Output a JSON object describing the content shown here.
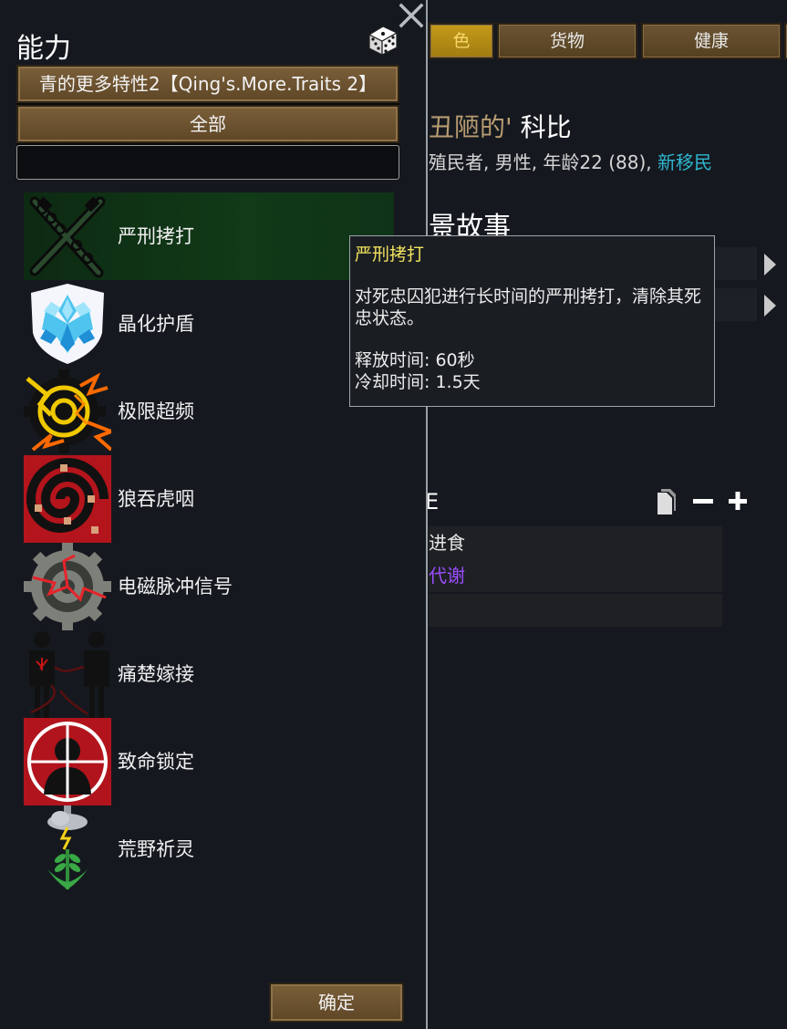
{
  "background": {
    "tabs": [
      "色",
      "货物",
      "健康"
    ],
    "name_prefix": "丑陋的'",
    "name": " 科比",
    "subtitle": "殖民者, 男性, 年龄22 (88),",
    "subtitle_link": "新移民",
    "story_header": "景故事",
    "section_header": "E",
    "traits": [
      "进食",
      "代谢"
    ],
    "trait_colors": [
      "#e8e8e8",
      "#9b4dff"
    ]
  },
  "dialog": {
    "title": "能力",
    "filter_mod": "青的更多特性2【Qing's.More.Traits 2】",
    "filter_category": "全部",
    "search_value": "",
    "confirm_label": "确定",
    "abilities": [
      {
        "label": "严刑拷打",
        "icon": "chain-torture-icon",
        "selected": true
      },
      {
        "label": "晶化护盾",
        "icon": "crystal-shield-icon",
        "selected": false
      },
      {
        "label": "极限超频",
        "icon": "overclock-gear-icon",
        "selected": false
      },
      {
        "label": "狼吞虎咽",
        "icon": "vortex-devour-icon",
        "selected": false
      },
      {
        "label": "电磁脉冲信号",
        "icon": "emp-gear-icon",
        "selected": false
      },
      {
        "label": "痛楚嫁接",
        "icon": "pain-graft-icon",
        "selected": false
      },
      {
        "label": "致命锁定",
        "icon": "crosshair-lock-icon",
        "selected": false
      },
      {
        "label": "荒野祈灵",
        "icon": "wild-prayer-icon",
        "selected": false
      }
    ]
  },
  "tooltip": {
    "title": "严刑拷打",
    "description": "对死忠囚犯进行长时间的严刑拷打，清除其死忠状态。",
    "cast_time": "释放时间: 60秒",
    "cooldown": "冷却时间: 1.5天"
  },
  "colors": {
    "accent_gold": "#c49a1a",
    "tooltip_title": "#f2e25d",
    "link_teal": "#2fb6cf",
    "selected_row": "#113a18"
  }
}
